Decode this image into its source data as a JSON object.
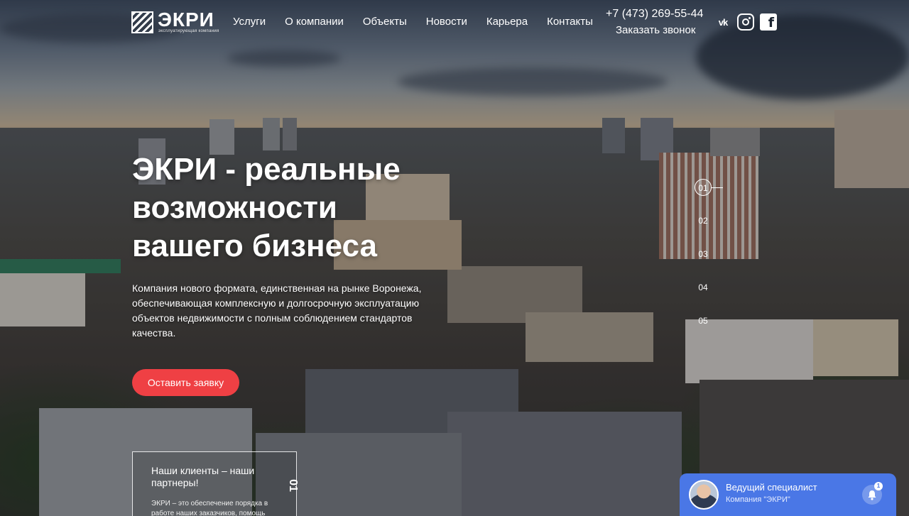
{
  "header": {
    "logo_text": "ЭКРИ",
    "logo_subtitle": "эксплуатирующая компания",
    "nav": [
      {
        "label": "Услуги"
      },
      {
        "label": "О компании"
      },
      {
        "label": "Объекты"
      },
      {
        "label": "Новости"
      },
      {
        "label": "Карьера"
      },
      {
        "label": "Контакты"
      }
    ],
    "phone": "+7 (473) 269-55-44",
    "callback_label": "Заказать звонок",
    "socials": [
      {
        "icon": "vk-icon",
        "glyph": "vk"
      },
      {
        "icon": "instagram-icon"
      },
      {
        "icon": "facebook-icon",
        "glyph": "f"
      }
    ]
  },
  "hero": {
    "title_lines": [
      "ЭКРИ - реальные",
      "возможности",
      "вашего бизнеса"
    ],
    "description": "Компания нового формата, единственная на рынке Воронежа, обеспечивающая комплексную и долгосрочную эксплуатацию объектов недвижимости с полным соблюдением стандартов качества.",
    "cta_label": "Оставить заявку"
  },
  "slider": {
    "items": [
      "01",
      "02",
      "03",
      "04",
      "05"
    ],
    "active_index": 0
  },
  "card": {
    "title": "Наши клиенты – наши партнеры!",
    "text": "ЭКРИ – это обеспечение порядка в работе наших заказчиков, помощь",
    "number": "01"
  },
  "chat": {
    "name": "Ведущий специалист",
    "org": "Компания \"ЭКРИ\"",
    "badge": "1",
    "accent": "#4a77e6"
  },
  "colors": {
    "cta": "#ef4044",
    "text": "#ffffff"
  }
}
